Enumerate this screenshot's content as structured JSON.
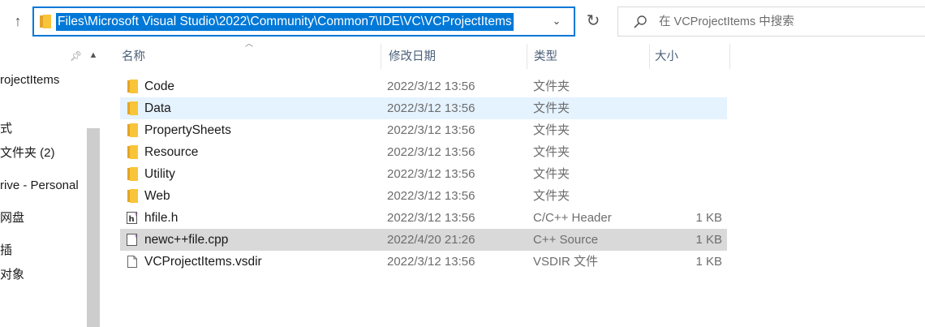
{
  "address_bar": {
    "path": "Files\\Microsoft Visual Studio\\2022\\Community\\Common7\\IDE\\VC\\VCProjectItems"
  },
  "search": {
    "placeholder": "在 VCProjectItems 中搜索"
  },
  "nav": {
    "items": [
      "rojectItems",
      "式",
      "文件夹 (2)",
      "rive - Personal",
      "网盘",
      "插",
      "对象"
    ]
  },
  "columns": {
    "name": "名称",
    "modified": "修改日期",
    "type": "类型",
    "size": "大小"
  },
  "files": [
    {
      "name": "Code",
      "modified": "2022/3/12 13:56",
      "type": "文件夹",
      "size": "",
      "icon": "folder-icon"
    },
    {
      "name": "Data",
      "modified": "2022/3/12 13:56",
      "type": "文件夹",
      "size": "",
      "icon": "folder-icon",
      "state": "hover"
    },
    {
      "name": "PropertySheets",
      "modified": "2022/3/12 13:56",
      "type": "文件夹",
      "size": "",
      "icon": "folder-icon"
    },
    {
      "name": "Resource",
      "modified": "2022/3/12 13:56",
      "type": "文件夹",
      "size": "",
      "icon": "folder-icon"
    },
    {
      "name": "Utility",
      "modified": "2022/3/12 13:56",
      "type": "文件夹",
      "size": "",
      "icon": "folder-icon"
    },
    {
      "name": "Web",
      "modified": "2022/3/12 13:56",
      "type": "文件夹",
      "size": "",
      "icon": "folder-icon"
    },
    {
      "name": "hfile.h",
      "modified": "2022/3/12 13:56",
      "type": "C/C++ Header",
      "size": "1 KB",
      "icon": "header-file-icon"
    },
    {
      "name": "newc++file.cpp",
      "modified": "2022/4/20 21:26",
      "type": "C++ Source",
      "size": "1 KB",
      "icon": "cpp-file-icon",
      "state": "selected"
    },
    {
      "name": "VCProjectItems.vsdir",
      "modified": "2022/3/12 13:56",
      "type": "VSDIR 文件",
      "size": "1 KB",
      "icon": "generic-file-icon"
    }
  ],
  "colors": {
    "accent": "#0078d7",
    "hover_row": "#e5f3ff",
    "selected_row": "#d9d9d9",
    "folder": "#f8c43a"
  }
}
